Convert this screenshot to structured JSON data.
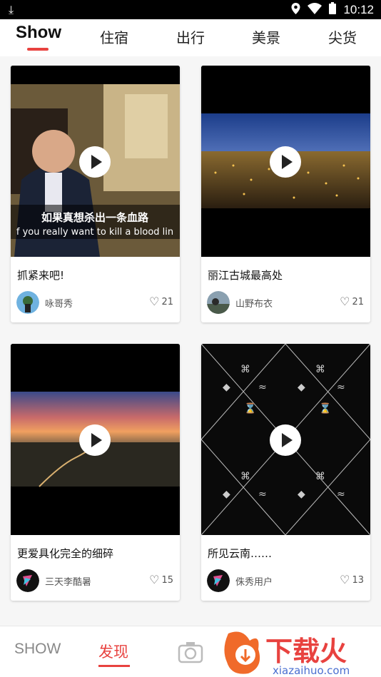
{
  "status_bar": {
    "time": "10:12"
  },
  "tabs": [
    {
      "label": "Show",
      "active": true
    },
    {
      "label": "住宿"
    },
    {
      "label": "出行"
    },
    {
      "label": "美景"
    },
    {
      "label": "尖货"
    }
  ],
  "cards": [
    {
      "title": "抓紧来吧!",
      "author": "咏哥秀",
      "likes": "21",
      "subtitle_cn": "如果真想杀出一条血路",
      "subtitle_en": "f you really want to kill a blood lin"
    },
    {
      "title": "丽江古城最高处",
      "author": "山野布衣",
      "likes": "21"
    },
    {
      "title": "更爱具化完全的细碎",
      "author": "三天李酷暑",
      "likes": "15"
    },
    {
      "title": "所见云南……",
      "author": "侏秀用户",
      "likes": "13"
    }
  ],
  "bottom_nav": {
    "show": "SHOW",
    "discover": "发现"
  },
  "watermark": {
    "brand": "下载火",
    "url": "xiazaihuo.com"
  },
  "colors": {
    "accent": "#e8423f"
  }
}
